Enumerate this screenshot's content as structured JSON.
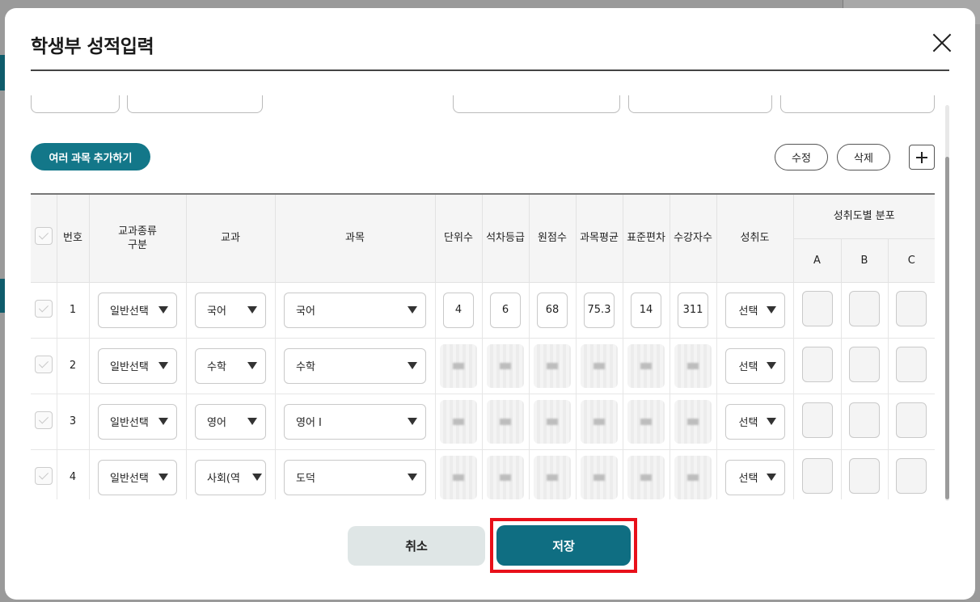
{
  "modal": {
    "title": "학생부 성적입력"
  },
  "toolbar": {
    "multi_add_label": "여러 과목 추가하기",
    "edit_label": "수정",
    "delete_label": "삭제"
  },
  "table": {
    "headers": {
      "number": "번호",
      "category": "교과종류\n구분",
      "subject_group": "교과",
      "subject": "과목",
      "credits": "단위수",
      "rank_grade": "석차등급",
      "raw_score": "원점수",
      "average": "과목평균",
      "std_dev": "표준편차",
      "students": "수강자수",
      "achievement": "성취도",
      "distribution": "성취도별 분포",
      "dist_a": "A",
      "dist_b": "B",
      "dist_c": "C"
    },
    "rows": [
      {
        "number": "1",
        "category": "일반선택",
        "subject_group": "국어",
        "subject": "국어",
        "credits": "4",
        "rank_grade": "6",
        "raw_score": "68",
        "average": "75.3",
        "std_dev": "14",
        "students": "311",
        "achievement": "선택"
      },
      {
        "number": "2",
        "category": "일반선택",
        "subject_group": "수학",
        "subject": "수학",
        "achievement": "선택"
      },
      {
        "number": "3",
        "category": "일반선택",
        "subject_group": "영어",
        "subject": "영어 I",
        "achievement": "선택"
      },
      {
        "number": "4",
        "category": "일반선택",
        "subject_group": "사회(역",
        "subject": "도덕",
        "achievement": "선택"
      }
    ]
  },
  "footer": {
    "cancel_label": "취소",
    "save_label": "저장"
  },
  "colors": {
    "primary": "#137789",
    "save": "#0f6e82",
    "highlight": "#e8101a"
  }
}
